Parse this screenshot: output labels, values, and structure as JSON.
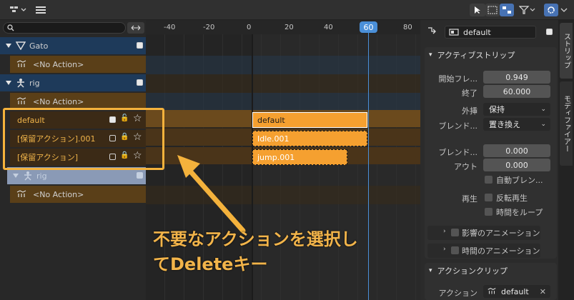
{
  "header": {
    "editor_icon": "nla-editor-icon",
    "menu_icon": "hamburger-menu-icon",
    "right_icons": [
      "select-arrow-icon",
      "box-select-icon",
      "snap-icon",
      "filter-icon",
      "sync-icon"
    ]
  },
  "channels": {
    "search_placeholder": "",
    "rows": [
      {
        "kind": "object",
        "label": "Gato",
        "icon": "mesh-triangle-icon"
      },
      {
        "kind": "action",
        "label": "<No Action>",
        "icon": "action-icon"
      },
      {
        "kind": "object",
        "label": "rig",
        "icon": "armature-icon"
      },
      {
        "kind": "action",
        "label": "<No Action>",
        "icon": "action-icon"
      },
      {
        "kind": "track",
        "label": "default"
      },
      {
        "kind": "track",
        "label": "[保留アクション].001"
      },
      {
        "kind": "track",
        "label": "[保留アクション]"
      },
      {
        "kind": "object-ghost",
        "label": "rig",
        "icon": "armature-icon"
      },
      {
        "kind": "action",
        "label": "<No Action>",
        "icon": "action-icon"
      }
    ]
  },
  "timeline": {
    "ticks": [
      "-40",
      "-20",
      "0",
      "20",
      "40",
      "60",
      "80"
    ],
    "current_frame": "60",
    "strips": [
      {
        "label": "default",
        "style": "solid"
      },
      {
        "label": "Idle.001",
        "style": "dashed"
      },
      {
        "label": "jump.001",
        "style": "dashed"
      }
    ]
  },
  "properties": {
    "header_strip_name": "default",
    "active_strip": {
      "title": "アクティブストリップ",
      "start_label": "開始フレ...",
      "start_value": "0.949",
      "end_label": "終了",
      "end_value": "60.000",
      "extrapolation_label": "外挿",
      "extrapolation_value": "保持",
      "blend_label": "ブレンド...",
      "blend_value": "置き換え",
      "blend_in_label": "ブレンド...",
      "blend_in_value": "0.000",
      "blend_out_label": "アウト",
      "blend_out_value": "0.000",
      "auto_blend_label": "自動ブレン...",
      "playback_label": "再生",
      "reverse_label": "反転再生",
      "cyclic_label": "時間をループ",
      "influence_label": "影響のアニメーション",
      "strip_time_label": "時間のアニメーション"
    },
    "action_clip": {
      "title": "アクションクリップ",
      "action_label": "アクション",
      "action_value": "default"
    }
  },
  "side_tabs": [
    "ストリップ",
    "モディファイアー"
  ],
  "annotation": {
    "line1": "不要なアクションを選択し",
    "line2": "てDeleteキー"
  },
  "colors": {
    "accent_orange": "#f4b23c",
    "strip_orange": "#f5a030",
    "playhead_blue": "#4a8fd8",
    "object_row": "#1e3a5a",
    "action_row": "#5a3f18"
  }
}
